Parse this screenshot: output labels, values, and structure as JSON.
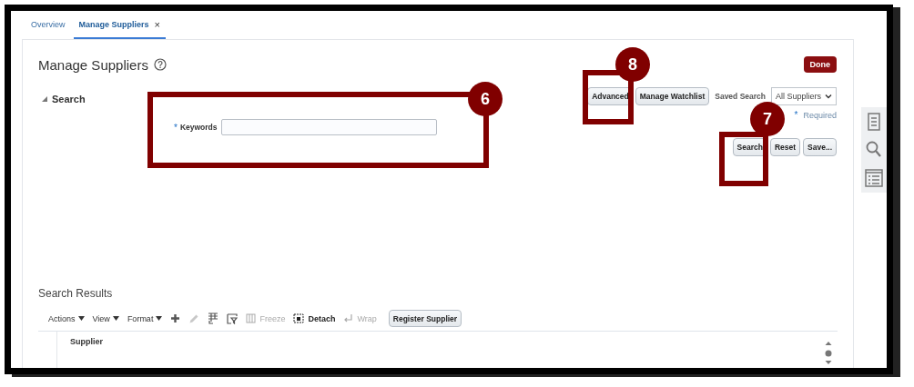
{
  "tabs": [
    {
      "label": "Overview",
      "selected": false
    },
    {
      "label": "Manage Suppliers",
      "selected": true,
      "close": "×"
    }
  ],
  "page": {
    "title": "Manage Suppliers",
    "done_button": "Done"
  },
  "search": {
    "heading": "Search",
    "expanded": true,
    "keywords": {
      "label": "Keywords",
      "required_mark": "*"
    },
    "top_buttons": [
      "Advanced",
      "Manage Watchlist"
    ],
    "saved_search": {
      "label": "Saved Search",
      "value": "All Suppliers"
    },
    "required_note": {
      "mark": "*",
      "text": "Required"
    },
    "bottom_buttons": [
      "Search",
      "Reset",
      "Save..."
    ]
  },
  "results": {
    "title": "Search Results",
    "menus": [
      "Actions",
      "View",
      "Format"
    ],
    "tools": [
      {
        "kind": "plus",
        "disabled": false
      },
      {
        "kind": "pencil",
        "disabled": true
      },
      {
        "kind": "columns",
        "disabled": false
      },
      {
        "kind": "query",
        "disabled": false
      },
      {
        "kind": "freeze",
        "label": "Freeze",
        "disabled": true
      },
      {
        "kind": "detach",
        "label": "Detach",
        "disabled": false
      },
      {
        "kind": "wrap",
        "label": "Wrap",
        "disabled": true
      }
    ],
    "register_button": "Register Supplier",
    "columns": [
      "Supplier"
    ]
  },
  "callouts": [
    {
      "number": "6"
    },
    {
      "number": "8"
    },
    {
      "number": "7"
    }
  ]
}
